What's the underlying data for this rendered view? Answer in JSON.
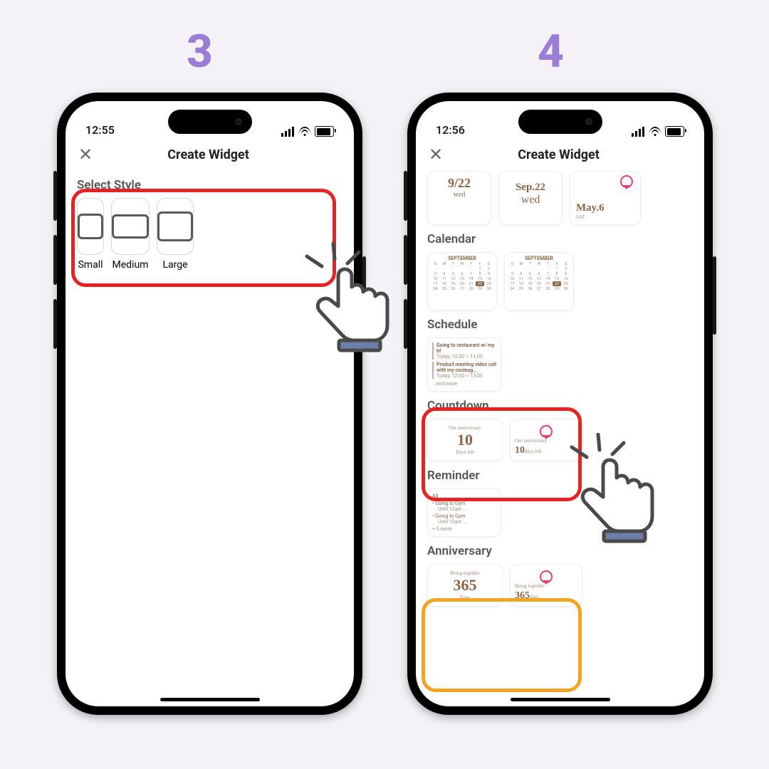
{
  "steps": {
    "s3": "3",
    "s4": "4"
  },
  "status": {
    "t3": "12:55",
    "t4": "12:56"
  },
  "nav": {
    "title": "Create Widget"
  },
  "s3": {
    "section": "Select Style",
    "labels": [
      "Small",
      "Medium",
      "Large"
    ]
  },
  "s4": {
    "date": {
      "a_big": "9/22",
      "a_sm": "wed",
      "b_big": "Sep.22",
      "b_sm": "wed",
      "c_big": "May.6",
      "c_sm": "SAT"
    },
    "cat_cal": "Calendar",
    "cal": {
      "month": "SEPTEMBER"
    },
    "cat_sch": "Schedule",
    "sch": [
      {
        "t": "Going to restaurant w/ my bf",
        "d": "Today, 10:00 ~ 11:00"
      },
      {
        "t": "Product meeting video call with my couleag...",
        "d": "Today, 12:00 ~ 13:00"
      }
    ],
    "sch_more": "...and more",
    "cat_cd": "Countdown",
    "cd": {
      "title": "Our anniversary",
      "num": "10",
      "unit": "Days left",
      "unit2": "days left"
    },
    "cat_rem": "Reminder",
    "rem": {
      "all": "All",
      "row": "Going to Gym",
      "row2": "Until 12am ...",
      "more": "+ 5 more"
    },
    "cat_ann": "Anniversary",
    "ann": {
      "title": "Being together",
      "num": "365",
      "unit": "Days",
      "unit2": "days"
    }
  }
}
